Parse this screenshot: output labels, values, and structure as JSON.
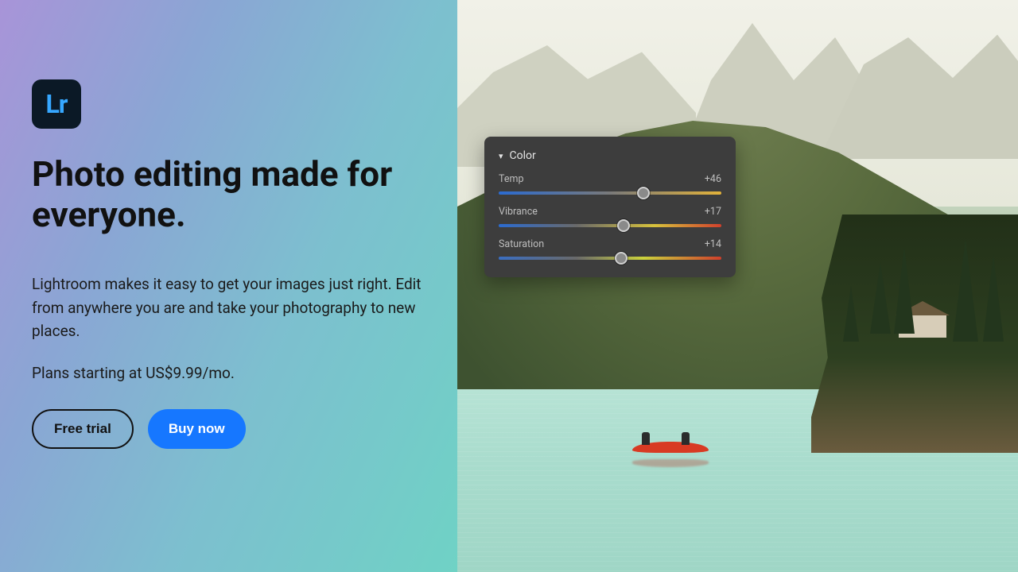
{
  "logo": {
    "label": "Lr"
  },
  "hero": {
    "headline": "Photo editing made for everyone.",
    "subcopy": "Lightroom makes it easy to get your images just right. Edit from anywhere you are and take your photography to new places.",
    "plans": "Plans starting at US$9.99/mo."
  },
  "cta": {
    "trial": "Free trial",
    "buy": "Buy now"
  },
  "color_panel": {
    "title": "Color",
    "sliders": [
      {
        "label": "Temp",
        "value": "+46",
        "pos_pct": 65
      },
      {
        "label": "Vibrance",
        "value": "+17",
        "pos_pct": 56
      },
      {
        "label": "Saturation",
        "value": "+14",
        "pos_pct": 55
      }
    ]
  },
  "colors": {
    "primary_button": "#1677ff",
    "panel_bg": "#3d3d3d",
    "logo_bg": "#0b1926",
    "logo_fg": "#36a7ff"
  }
}
